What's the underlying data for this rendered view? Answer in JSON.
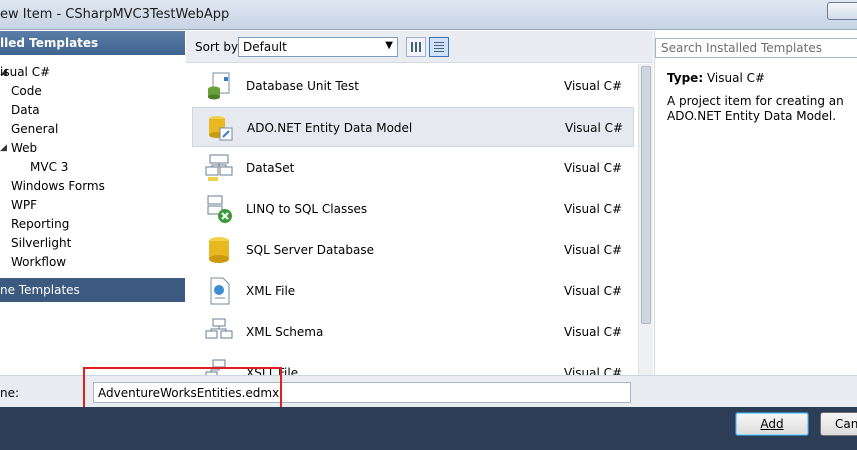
{
  "window": {
    "title": "ew Item - CSharpMVC3TestWebApp"
  },
  "left_panel": {
    "header": "lled Templates",
    "tree": [
      {
        "label": "isual C#",
        "indent": 0
      },
      {
        "label": "Code",
        "indent": 1
      },
      {
        "label": "Data",
        "indent": 1
      },
      {
        "label": "General",
        "indent": 1
      },
      {
        "label": "Web",
        "indent": 1
      },
      {
        "label": "MVC 3",
        "indent": 2
      },
      {
        "label": "Windows Forms",
        "indent": 1
      },
      {
        "label": "WPF",
        "indent": 1
      },
      {
        "label": "Reporting",
        "indent": 1
      },
      {
        "label": "Silverlight",
        "indent": 1
      },
      {
        "label": "Workflow",
        "indent": 1
      }
    ],
    "online_templates": "ne Templates"
  },
  "toolbar": {
    "sort_label": "Sort by:",
    "sort_value": "Default"
  },
  "templates": [
    {
      "name": "Database Unit Test",
      "language": "Visual C#",
      "icon": "database-unit-test-icon"
    },
    {
      "name": "ADO.NET Entity Data Model",
      "language": "Visual C#",
      "icon": "entity-data-model-icon",
      "selected": true
    },
    {
      "name": "DataSet",
      "language": "Visual C#",
      "icon": "dataset-icon"
    },
    {
      "name": "LINQ to SQL Classes",
      "language": "Visual C#",
      "icon": "linq-to-sql-icon"
    },
    {
      "name": "SQL Server Database",
      "language": "Visual C#",
      "icon": "sql-database-icon"
    },
    {
      "name": "XML File",
      "language": "Visual C#",
      "icon": "xml-file-icon"
    },
    {
      "name": "XML Schema",
      "language": "Visual C#",
      "icon": "xml-schema-icon"
    },
    {
      "name": "XSLT File",
      "language": "Visual C#",
      "icon": "xslt-file-icon"
    }
  ],
  "right_panel": {
    "search_placeholder": "Search Installed Templates",
    "type_label": "Type:",
    "type_value": "Visual C#",
    "description": "A project item for creating an ADO.NET Entity Data Model."
  },
  "name_row": {
    "label": "ne:",
    "value": "AdventureWorksEntities.edmx"
  },
  "buttons": {
    "add": "Add",
    "cancel": "Can"
  },
  "colors": {
    "selection_highlight": "#e02020",
    "header_blue": "#3f6390",
    "footer": "#2c3e56"
  }
}
